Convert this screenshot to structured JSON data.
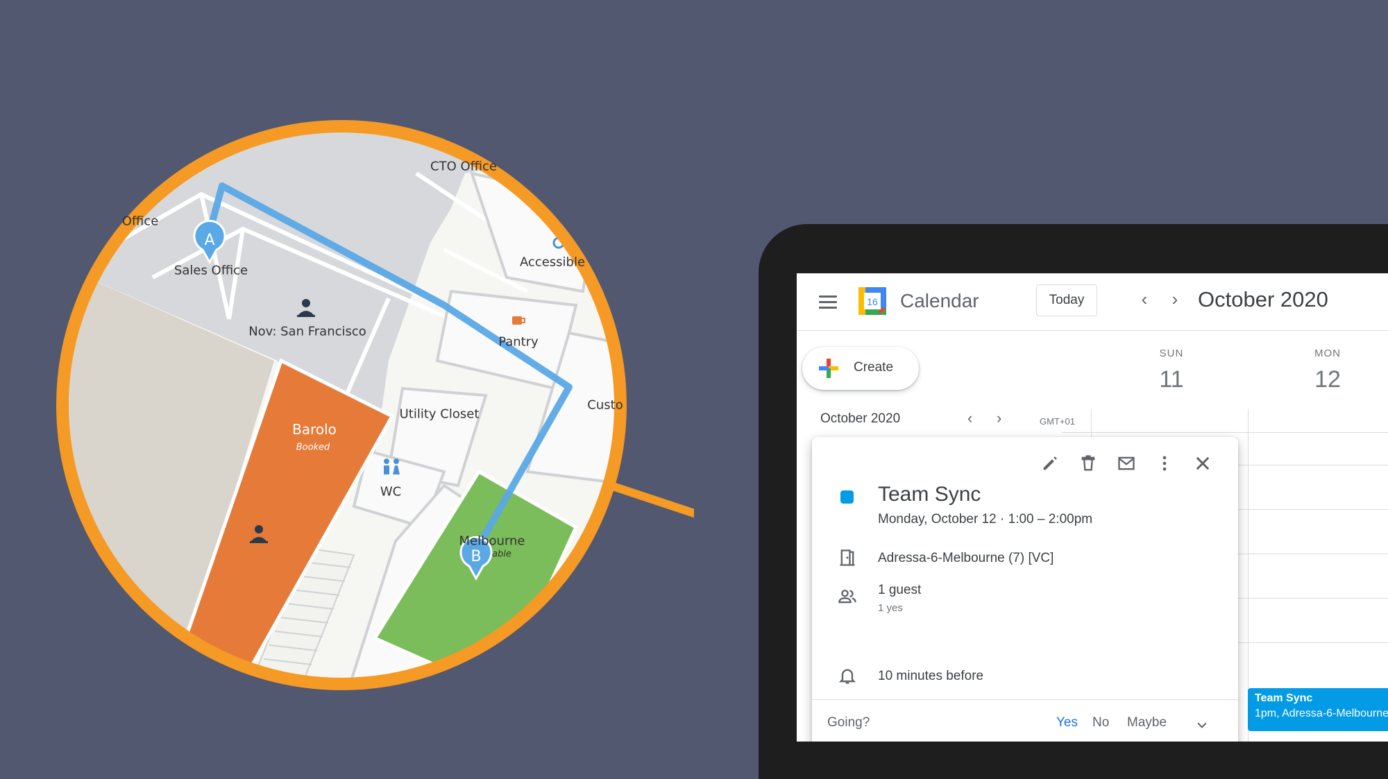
{
  "map": {
    "rooms": {
      "cto_office": "CTO Office",
      "office": "Office",
      "sales_office": "Sales Office",
      "accessible": "Accessible",
      "nov_san_francisco": "Nov: San Francisco",
      "pantry": "Pantry",
      "custom": "Custo",
      "barolo": "Barolo",
      "barolo_status": "Booked",
      "utility_closet": "Utility Closet",
      "wc": "WC",
      "melbourne": "Melbourne",
      "melbourne_status": "able"
    },
    "markers": {
      "start": "A",
      "end": "B"
    },
    "colors": {
      "ring": "#f49a25",
      "route": "#5aa8e6",
      "booked": "#e57a39",
      "available": "#7bbd5a",
      "background": "#525870"
    }
  },
  "calendar": {
    "app_title": "Calendar",
    "logo_day": "16",
    "today_label": "Today",
    "prev_arrow": "‹",
    "next_arrow": "›",
    "month_title": "October 2020",
    "create_label": "Create",
    "days": [
      {
        "dow": "SUN",
        "num": "11"
      },
      {
        "dow": "MON",
        "num": "12"
      }
    ],
    "mini_month": "October 2020",
    "timezone": "GMT+01",
    "event_popup": {
      "title": "Team Sync",
      "when": "Monday, October 12  ·  1:00 – 2:00pm",
      "room": "Adressa-6-Melbourne (7) [VC]",
      "guests": "1 guest",
      "guests_sub": "1 yes",
      "reminder": "10 minutes before",
      "going_label": "Going?",
      "rsvp": {
        "yes": "Yes",
        "no": "No",
        "maybe": "Maybe"
      },
      "color": "#039be5"
    },
    "event_block": {
      "title": "Team Sync",
      "subtitle": "1pm, Adressa-6-Melbourne"
    }
  }
}
